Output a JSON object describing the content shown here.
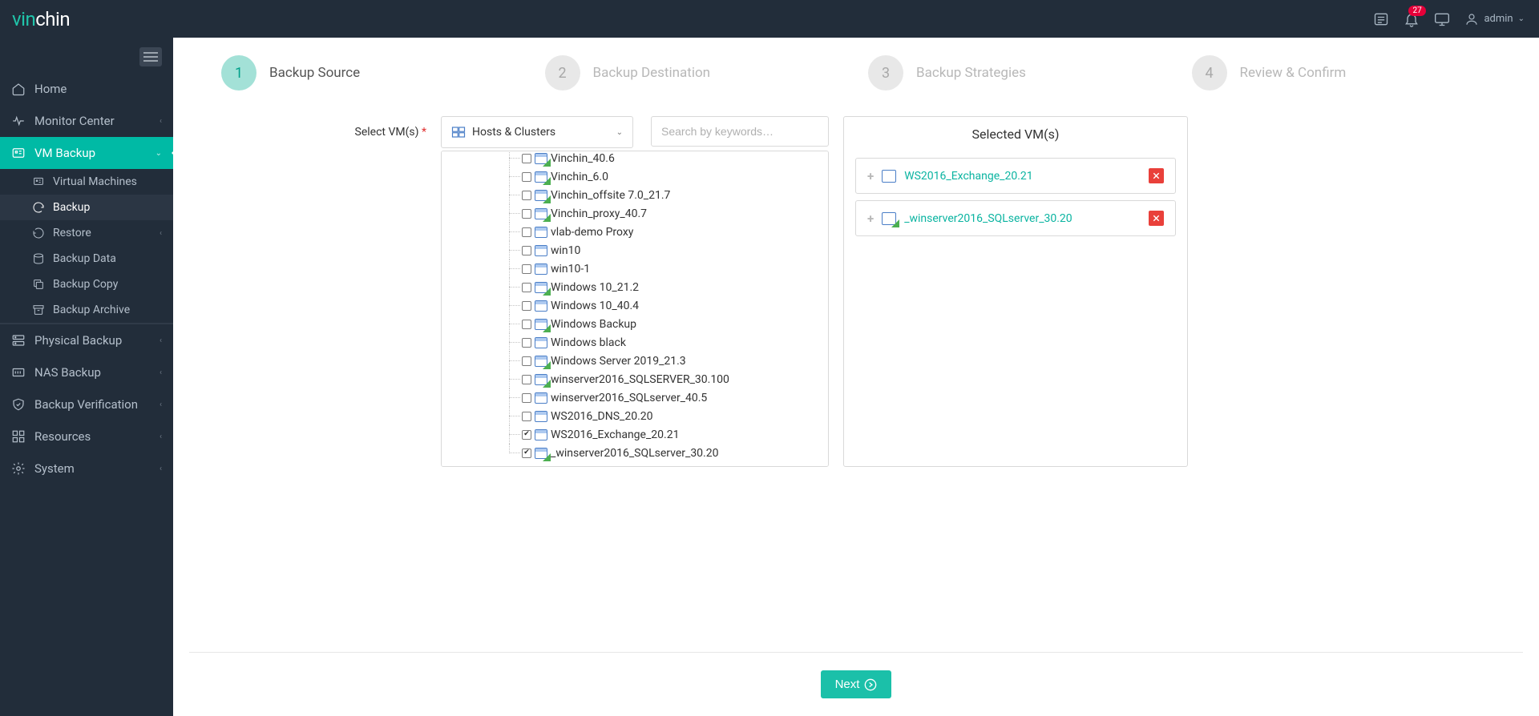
{
  "brand": {
    "part1": "vin",
    "part2": "chin"
  },
  "header": {
    "notification_count": "27",
    "user": "admin"
  },
  "sidebar": {
    "items": [
      {
        "key": "home",
        "label": "Home"
      },
      {
        "key": "monitor",
        "label": "Monitor Center",
        "expandable": true
      },
      {
        "key": "vmbackup",
        "label": "VM Backup",
        "active": true,
        "expandable": true,
        "open": true,
        "children": [
          {
            "key": "virtual-machines",
            "label": "Virtual Machines"
          },
          {
            "key": "backup",
            "label": "Backup",
            "active": true
          },
          {
            "key": "restore",
            "label": "Restore",
            "expandable": true
          },
          {
            "key": "backup-data",
            "label": "Backup Data"
          },
          {
            "key": "backup-copy",
            "label": "Backup Copy"
          },
          {
            "key": "backup-archive",
            "label": "Backup Archive"
          }
        ]
      },
      {
        "key": "physical",
        "label": "Physical Backup",
        "expandable": true
      },
      {
        "key": "nas",
        "label": "NAS Backup",
        "expandable": true
      },
      {
        "key": "verify",
        "label": "Backup Verification",
        "expandable": true
      },
      {
        "key": "resources",
        "label": "Resources",
        "expandable": true
      },
      {
        "key": "system",
        "label": "System",
        "expandable": true
      }
    ]
  },
  "wizard": {
    "steps": [
      {
        "num": "1",
        "label": "Backup Source",
        "active": true
      },
      {
        "num": "2",
        "label": "Backup Destination"
      },
      {
        "num": "3",
        "label": "Backup Strategies"
      },
      {
        "num": "4",
        "label": "Review & Confirm"
      }
    ],
    "select_label": "Select VM(s)",
    "view_selector": "Hosts & Clusters",
    "search_placeholder": "Search by keywords…",
    "next_button": "Next"
  },
  "tree": {
    "nodes": [
      {
        "name": "Vinchin_40.6",
        "running": true,
        "checked": false
      },
      {
        "name": "Vinchin_6.0",
        "running": true,
        "checked": false
      },
      {
        "name": "Vinchin_offsite 7.0_21.7",
        "running": true,
        "checked": false
      },
      {
        "name": "Vinchin_proxy_40.7",
        "running": true,
        "checked": false
      },
      {
        "name": "vlab-demo Proxy",
        "running": false,
        "checked": false
      },
      {
        "name": "win10",
        "running": false,
        "checked": false
      },
      {
        "name": "win10-1",
        "running": false,
        "checked": false
      },
      {
        "name": "Windows 10_21.2",
        "running": true,
        "checked": false
      },
      {
        "name": "Windows 10_40.4",
        "running": false,
        "checked": false
      },
      {
        "name": "Windows Backup",
        "running": true,
        "checked": false
      },
      {
        "name": "Windows black",
        "running": false,
        "checked": false
      },
      {
        "name": "Windows Server 2019_21.3",
        "running": true,
        "checked": false
      },
      {
        "name": "winserver2016_SQLSERVER_30.100",
        "running": true,
        "checked": false
      },
      {
        "name": "winserver2016_SQLserver_40.5",
        "running": false,
        "checked": false
      },
      {
        "name": "WS2016_DNS_20.20",
        "running": false,
        "checked": false
      },
      {
        "name": "WS2016_Exchange_20.21",
        "running": false,
        "checked": true
      },
      {
        "name": "_winserver2016_SQLserver_30.20",
        "running": true,
        "checked": true
      }
    ]
  },
  "selected": {
    "title": "Selected VM(s)",
    "items": [
      {
        "name": "WS2016_Exchange_20.21",
        "running": false
      },
      {
        "name": "_winserver2016_SQLserver_30.20",
        "running": true
      }
    ]
  }
}
